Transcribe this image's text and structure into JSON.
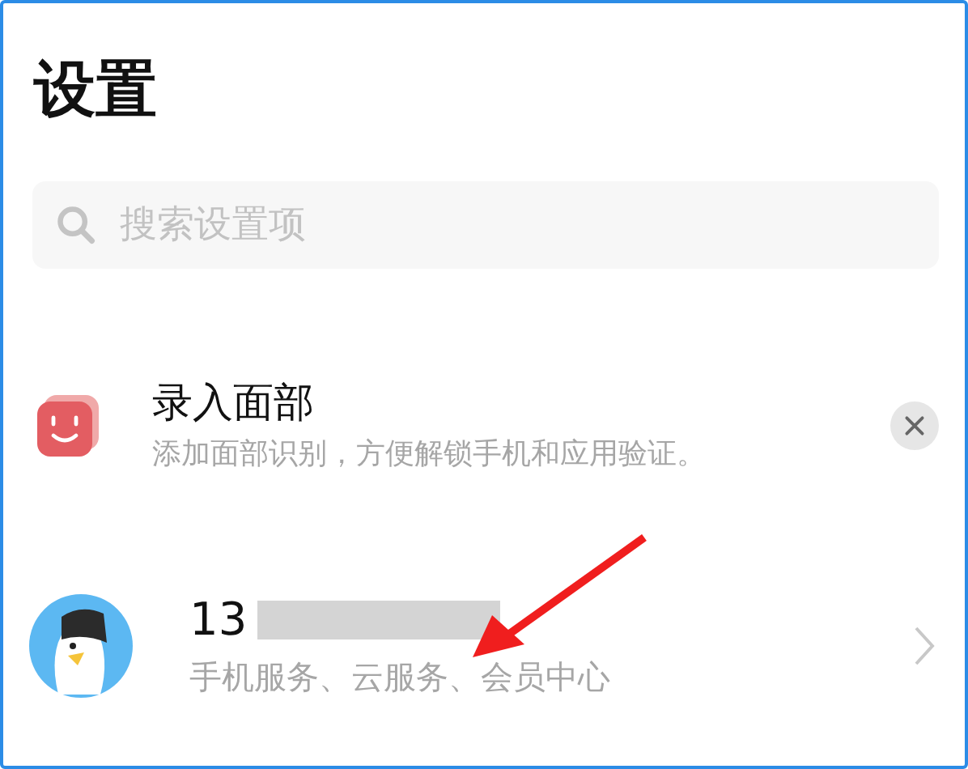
{
  "title": "设置",
  "search": {
    "placeholder": "搜索设置项"
  },
  "suggestion": {
    "title": "录入面部",
    "subtitle": "添加面部识别，方便解锁手机和应用验证。"
  },
  "account": {
    "number_visible": "13",
    "subtitle": "手机服务、云服务、会员中心"
  }
}
